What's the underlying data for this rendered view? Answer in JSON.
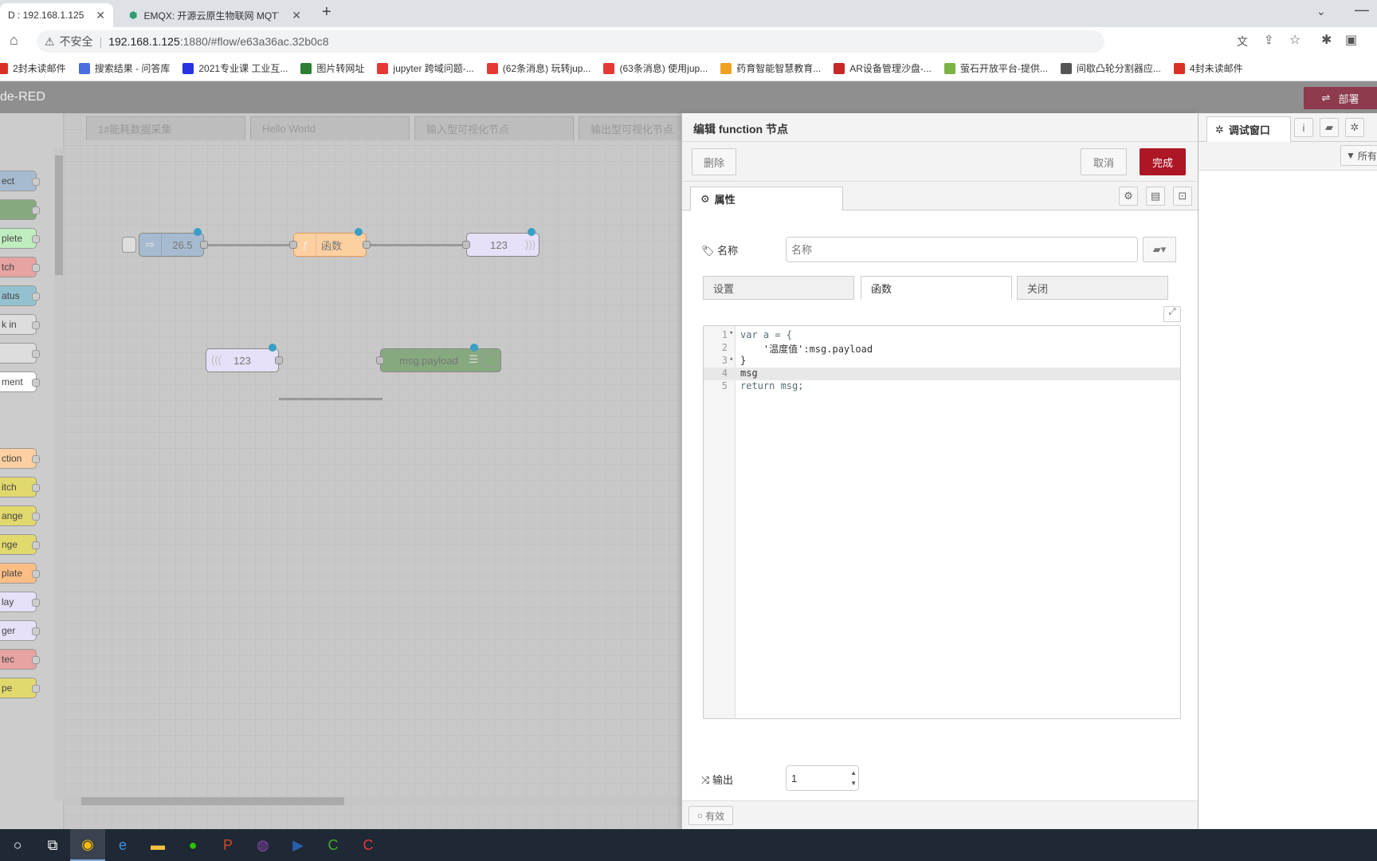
{
  "browser": {
    "tabs": [
      {
        "title": "D : 192.168.1.125",
        "active": true
      },
      {
        "title": "EMQX: 开源云原生物联网 MQTT",
        "active": false
      }
    ],
    "new_tab": "+",
    "security_label": "不安全",
    "url_host": "192.168.1.125",
    "url_rest": ":1880/#flow/e63a36ac.32b0c8",
    "bookmarks": [
      {
        "label": "2封未读邮件",
        "icon": "gmail-icon",
        "color": "#d93025"
      },
      {
        "label": "搜索结果 - 问答库",
        "icon": "search-site-icon",
        "color": "#4a6ee0"
      },
      {
        "label": "2021专业课 工业互...",
        "icon": "baidu-icon",
        "color": "#2932e1"
      },
      {
        "label": "图片转网址",
        "icon": "chart-bars-icon",
        "color": "#2e7d32"
      },
      {
        "label": "jupyter 跨域问题-...",
        "icon": "csdn-icon",
        "color": "#e53935"
      },
      {
        "label": "(62条消息) 玩转jup...",
        "icon": "csdn-icon",
        "color": "#e53935"
      },
      {
        "label": "(63条消息) 使用jup...",
        "icon": "csdn-icon",
        "color": "#e53935"
      },
      {
        "label": "药育智能智慧教育...",
        "icon": "puzzle-site-icon",
        "color": "#f0a020"
      },
      {
        "label": "AR设备管理沙盘-...",
        "icon": "ar-icon",
        "color": "#c62828"
      },
      {
        "label": "萤石开放平台-提供...",
        "icon": "ys-icon",
        "color": "#7cb342"
      },
      {
        "label": "间歇凸轮分割器应...",
        "icon": "globe-icon",
        "color": "#555555"
      },
      {
        "label": "4封未读邮件",
        "icon": "gmail-icon",
        "color": "#d93025"
      }
    ]
  },
  "nodered": {
    "title": "de-RED",
    "deploy_label": "部署",
    "workspace_tabs": [
      "1#能耗数据采集",
      "Hello World",
      "输入型可视化节点",
      "输出型可视化节点"
    ],
    "palette_nodes": [
      {
        "label": "ect",
        "color": "#a6bbcf"
      },
      {
        "label": "",
        "color": "#87a980"
      },
      {
        "label": "plete",
        "color": "#c0edc0"
      },
      {
        "label": "tch",
        "color": "#e7a2a2"
      },
      {
        "label": "atus",
        "color": "#94c1d0"
      },
      {
        "label": "k in",
        "color": "#dddddd"
      },
      {
        "label": "",
        "color": "#dddddd"
      },
      {
        "label": "ment",
        "color": "#ffffff"
      },
      {
        "label": "ction",
        "color": "#fdd0a2"
      },
      {
        "label": "itch",
        "color": "#e2d96e"
      },
      {
        "label": "ange",
        "color": "#e2d96e"
      },
      {
        "label": "nge",
        "color": "#e2d96e"
      },
      {
        "label": "plate",
        "color": "#fdbe85"
      },
      {
        "label": "lay",
        "color": "#e6e0f8"
      },
      {
        "label": "ger",
        "color": "#e6e0f8"
      },
      {
        "label": "tec",
        "color": "#e7a2a2"
      },
      {
        "label": "pe",
        "color": "#e2d96e"
      }
    ],
    "flow_nodes": {
      "inject": "26.5",
      "function": "函数",
      "ui_out": "123",
      "ui_in": "123",
      "debug": "msg.payload"
    }
  },
  "tray": {
    "title": "编辑 function 节点",
    "delete_label": "删除",
    "cancel_label": "取消",
    "done_label": "完成",
    "properties_tab": "属性",
    "name_label": "名称",
    "name_placeholder": "名称",
    "subtabs": [
      "设置",
      "函数",
      "关闭"
    ],
    "code_lines": [
      {
        "num": "1",
        "fold": "▾",
        "text": "var a = {"
      },
      {
        "num": "2",
        "fold": "",
        "text": "    '温度值':msg.payload"
      },
      {
        "num": "3",
        "fold": "▴",
        "text": "}"
      },
      {
        "num": "4",
        "fold": "",
        "text": "msg"
      },
      {
        "num": "5",
        "fold": "",
        "text": "return msg;"
      }
    ],
    "output_label": "输出",
    "output_value": "1",
    "enabled_label": "有效"
  },
  "sidebar": {
    "debug_tab": "调试窗口",
    "filter_label": "所有"
  },
  "colors": {
    "deploy": "#8d3b4d",
    "done": "#ad1625",
    "node_dot": "#3a9fc4"
  }
}
